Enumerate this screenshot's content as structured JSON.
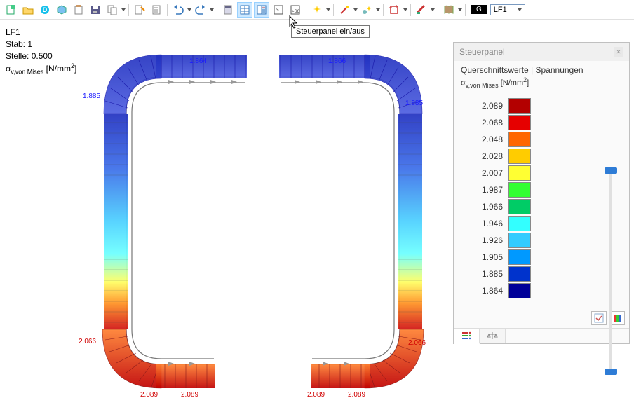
{
  "toolbar": {
    "lf_badge": "G",
    "lf_value": "LF1",
    "tooltip": "Steuerpanel ein/aus"
  },
  "info": {
    "line1": "LF1",
    "line2_label": "Stab:",
    "line2_val": "1",
    "line3_label": "Stelle:",
    "line3_val": "0.500",
    "sigma_label": "σ",
    "sigma_sub": "v,von Mises",
    "sigma_unit_pre": "[N/mm",
    "sigma_unit_sup": "2",
    "sigma_unit_post": "]"
  },
  "stress_labels": {
    "top_left": "1.864",
    "top_right": "1.866",
    "mid_left": "1.885",
    "mid_right": "1.885",
    "low_left": "2.066",
    "low_right": "2.066",
    "bot_l1": "2.089",
    "bot_l2": "2.089",
    "bot_r1": "2.089",
    "bot_r2": "2.089"
  },
  "panel": {
    "title": "Steuerpanel",
    "subtitle": "Querschnittswerte | Spannungen",
    "sigma_label": "σ",
    "sigma_sub": "v,von Mises",
    "sigma_unit_pre": "[N/mm",
    "sigma_unit_sup": "2",
    "sigma_unit_post": "]"
  },
  "legend": [
    {
      "v": "2.089",
      "c": "#b30000"
    },
    {
      "v": "2.068",
      "c": "#e60000"
    },
    {
      "v": "2.048",
      "c": "#ff6600"
    },
    {
      "v": "2.028",
      "c": "#ffcc00"
    },
    {
      "v": "2.007",
      "c": "#ffff33"
    },
    {
      "v": "1.987",
      "c": "#33ff33"
    },
    {
      "v": "1.966",
      "c": "#00cc66"
    },
    {
      "v": "1.946",
      "c": "#33ffff"
    },
    {
      "v": "1.926",
      "c": "#33ccff"
    },
    {
      "v": "1.905",
      "c": "#0099ff"
    },
    {
      "v": "1.885",
      "c": "#0033cc"
    },
    {
      "v": "1.864",
      "c": "#000099"
    }
  ],
  "chart_data": {
    "type": "heatmap",
    "title": "Querschnittswerte | Spannungen — σ_v,von Mises [N/mm²]",
    "colorbar_values": [
      1.864,
      1.885,
      1.905,
      1.926,
      1.946,
      1.966,
      1.987,
      2.007,
      2.028,
      2.048,
      2.068,
      2.089
    ],
    "value_range": [
      1.864,
      2.089
    ],
    "annotations": [
      {
        "pos": "top-left",
        "value": 1.864
      },
      {
        "pos": "top-right",
        "value": 1.866
      },
      {
        "pos": "mid-left",
        "value": 1.885
      },
      {
        "pos": "mid-right",
        "value": 1.885
      },
      {
        "pos": "lower-left",
        "value": 2.066
      },
      {
        "pos": "lower-right",
        "value": 2.066
      },
      {
        "pos": "bottom-left-a",
        "value": 2.089
      },
      {
        "pos": "bottom-left-b",
        "value": 2.089
      },
      {
        "pos": "bottom-right-a",
        "value": 2.089
      },
      {
        "pos": "bottom-right-b",
        "value": 2.089
      }
    ],
    "load_case": "LF1",
    "member": 1,
    "location": 0.5
  }
}
